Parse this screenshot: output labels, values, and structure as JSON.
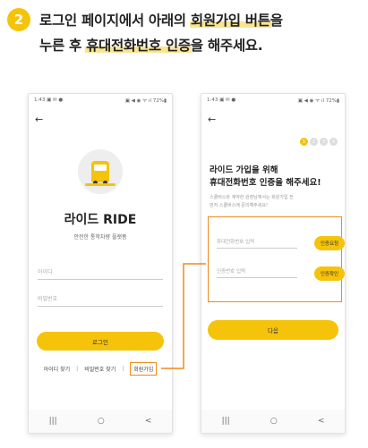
{
  "step": {
    "number": "2",
    "line1_prefix": "로그인 페이지에서 아래의 ",
    "line1_highlight": "회원가입 버튼",
    "line1_suffix": "을",
    "line2_prefix": "누른 후 ",
    "line2_highlight": "휴대전화번호 인증",
    "line2_suffix": "을 해주세요."
  },
  "status_bar": {
    "time": "1:43",
    "left_icons": "▣ ✉ ●",
    "right_icons": "▣ ◀ ◉ ᯤ ıl 72%▮"
  },
  "login_screen": {
    "back": "←",
    "app_name": "라이드 RIDE",
    "subtitle": "안전한 통학차량 플랫폼",
    "id_placeholder": "아이디",
    "password_placeholder": "비밀번호",
    "login_button": "로그인",
    "link_find_id": "아이디 찾기",
    "link_find_password": "비밀번호 찾기",
    "link_signup": "회원가입",
    "separator": "|"
  },
  "verify_screen": {
    "back": "←",
    "steps": [
      "1",
      "2",
      "3",
      "4"
    ],
    "title_line1": "라이드 가입을 위해",
    "title_line2": "휴대전화번호 인증을 해주세요!",
    "desc_line1": "스쿨버스와 계약한 원장님께서는 회원가입 전",
    "desc_line2": "먼저 스쿨버스에 문의해주세요!",
    "phone_placeholder": "휴대전화번호 입력",
    "request_button": "인증요청",
    "code_placeholder": "인증번호 입력",
    "confirm_button": "인증확인",
    "next_button": "다음"
  },
  "nav_bar": {
    "recent": "|||",
    "home": "○",
    "back": "<"
  },
  "colors": {
    "accent": "#f5c30a",
    "highlight_border": "#f08a1c"
  }
}
